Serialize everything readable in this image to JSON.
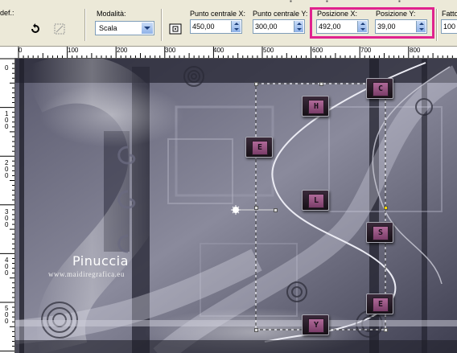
{
  "toolbar": {
    "preset_label": "def.:",
    "mode": {
      "label": "Modalità:",
      "value": "Scala"
    },
    "center_x": {
      "label": "Punto centrale X:",
      "value": "450,00"
    },
    "center_y": {
      "label": "Punto centrale Y:",
      "value": "300,00"
    },
    "pos_x": {
      "label": "Posizione X:",
      "value": "492,00"
    },
    "pos_y": {
      "label": "Posizione Y:",
      "value": "39,00"
    },
    "scale": {
      "label": "Fatto",
      "value": "100"
    },
    "highlight_color": "#e0228e"
  },
  "rulers": {
    "top": [
      "0",
      "100",
      "200",
      "300",
      "400",
      "500",
      "600",
      "700",
      "800"
    ],
    "left": [
      "0",
      "100",
      "200",
      "300",
      "400",
      "500"
    ]
  },
  "canvas": {
    "watermark_name": "Pinuccia",
    "watermark_url": "www.maidiregrafica.eu",
    "letters": [
      "C",
      "H",
      "E",
      "L",
      "S",
      "E",
      "Y"
    ]
  }
}
